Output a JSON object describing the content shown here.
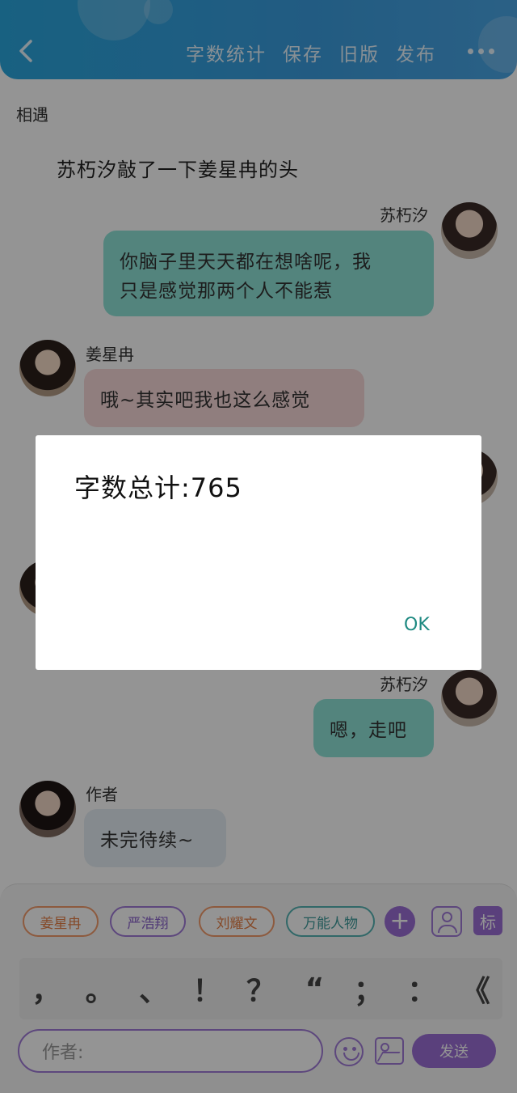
{
  "header": {
    "actions": [
      "字数统计",
      "保存",
      "旧版",
      "发布"
    ],
    "colors": {
      "gradient_start": "#2aa7df",
      "gradient_end": "#4aa6e6"
    }
  },
  "chat": {
    "chapter_title": "相遇",
    "narration": "苏朽汐敲了一下姜星冉的头",
    "messages": [
      {
        "speaker": "苏朽汐",
        "side": "right",
        "text_line1": "你脑子里天天都在想啥呢，我",
        "text_line2": "只是感觉那两个人不能惹",
        "color": "#8fe3d8"
      },
      {
        "speaker": "姜星冉",
        "side": "left",
        "text": "哦~其实吧我也这么感觉",
        "color": "#f8d9d9"
      },
      {
        "speaker": "苏朽汐",
        "side": "right",
        "text": "嗯，走吧",
        "color": "#8fe3d8"
      },
      {
        "speaker": "作者",
        "side": "left",
        "text": "未完待续~",
        "color": "#e6eef4"
      }
    ]
  },
  "composer": {
    "characters": [
      "姜星冉",
      "严浩翔",
      "刘耀文",
      "万能人物"
    ],
    "tag_label": "标",
    "punctuation": [
      "，",
      "。",
      "、",
      "！",
      "？",
      "“",
      "；",
      "：",
      "《"
    ],
    "input_placeholder": "作者:",
    "send_label": "发送",
    "accent_color": "#9b6fd6"
  },
  "dialog": {
    "message": "字数总计:765",
    "ok_label": "OK"
  }
}
